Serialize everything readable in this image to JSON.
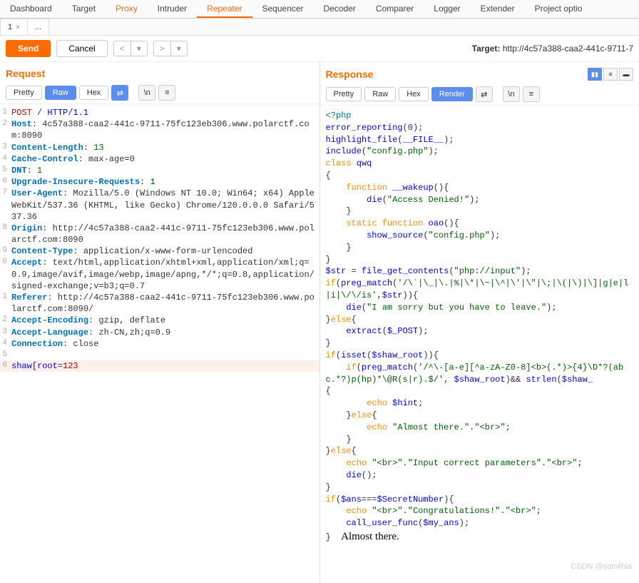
{
  "mainTabs": [
    "Dashboard",
    "Target",
    "Proxy",
    "Intruder",
    "Repeater",
    "Sequencer",
    "Decoder",
    "Comparer",
    "Logger",
    "Extender",
    "Project optio"
  ],
  "activeMainTab": "Repeater",
  "orangeTabs": [
    "Proxy",
    "Repeater"
  ],
  "subTabs": [
    {
      "label": "1",
      "close": true
    },
    {
      "label": "...",
      "close": false
    }
  ],
  "toolbar": {
    "send": "Send",
    "cancel": "Cancel",
    "prev": "<",
    "dd": "▾",
    "next": ">",
    "dd2": "▾",
    "targetLabel": "Target: ",
    "targetUrl": "http://4c57a388-caa2-441c-9711-7"
  },
  "request": {
    "title": "Request",
    "formats": [
      "Pretty",
      "Raw",
      "Hex"
    ],
    "selected": "Raw",
    "lines": [
      {
        "n": "1",
        "html": "<span class='r'>POST</span> / <span class='b'>HTTP/1.1</span>"
      },
      {
        "n": "2",
        "html": "<span class='k'>Host</span>: 4c57a388-caa2-441c-9711-75fc123eb306.www.polarctf.com:8090"
      },
      {
        "n": "3",
        "html": "<span class='k'>Content-Length</span>: <span class='v'>13</span>"
      },
      {
        "n": "4",
        "html": "<span class='k'>Cache-Control</span>: max-age=0"
      },
      {
        "n": "5",
        "html": "<span class='k'>DNT</span>: <span class='v'>1</span>"
      },
      {
        "n": "6",
        "html": "<span class='k'>Upgrade-Insecure-Requests</span>: <span class='v'>1</span>"
      },
      {
        "n": "7",
        "html": "<span class='k'>User-Agent</span>: Mozilla/5.0 (Windows NT 10.0; Win64; x64) AppleWebKit/537.36 (KHTML, like Gecko) Chrome/120.0.0.0 Safari/537.36"
      },
      {
        "n": "8",
        "html": "<span class='k'>Origin</span>: http://4c57a388-caa2-441c-9711-75fc123eb306.www.polarctf.com:8090"
      },
      {
        "n": "9",
        "html": "<span class='k'>Content-Type</span>: application/x-www-form-urlencoded"
      },
      {
        "n": "0",
        "html": "<span class='k'>Accept</span>: text/html,application/xhtml+xml,application/xml;q=0.9,image/avif,image/webp,image/apng,*/*;q=0.8,application/signed-exchange;v=b3;q=0.7"
      },
      {
        "n": "1",
        "html": "<span class='k'>Referer</span>: http://4c57a388-caa2-441c-9711-75fc123eb306.www.polarctf.com:8090/"
      },
      {
        "n": "2",
        "html": "<span class='k'>Accept-Encoding</span>: gzip, deflate"
      },
      {
        "n": "3",
        "html": "<span class='k'>Accept-Language</span>: zh-CN,zh;q=0.9"
      },
      {
        "n": "4",
        "html": "<span class='k'>Connection</span>: close"
      },
      {
        "n": "5",
        "html": ""
      },
      {
        "n": "6",
        "html": "<span class='b'>shaw[root</span>=<span class='r'>123</span>",
        "hl": true
      }
    ]
  },
  "response": {
    "title": "Response",
    "formats": [
      "Pretty",
      "Raw",
      "Hex",
      "Render"
    ],
    "selected": "Render",
    "bodyHtml": "<span class='p'>&lt;?php</span>\n<span class='b'>error_reporting</span>(<span class='m'>0</span>);\n<span class='b'>highlight_file</span>(<span class='b'>__FILE__</span>);\n<span class='b'>include</span>(<span class='s'>\"config.php\"</span>);\n<span class='o'>class</span> <span class='b'>qwq</span>\n{\n    <span class='o'>function</span> <span class='b'>__wakeup</span>(){\n        <span class='b'>die</span>(<span class='s'>\"Access Denied!\"</span>);\n    }\n    <span class='o'>static</span> <span class='o'>function</span> <span class='b'>oao</span>(){\n        <span class='b'>show_source</span>(<span class='s'>\"config.php\"</span>);\n    }\n}\n<span class='b'>$str</span> = <span class='b'>file_get_contents</span>(<span class='s'>\"php://input\"</span>);\n<span class='o'>if</span>(<span class='b'>preg_match</span>(<span class='s'>'/\\`|\\_|\\.|%|\\*|\\~|\\^|\\'|\\\"|\\;|\\(|\\)|\\]|g|e|l|i|\\/\\/is'</span>,<span class='b'>$str</span>)){\n    <span class='b'>die</span>(<span class='s'>\"I am sorry but you have to leave.\"</span>);\n}<span class='o'>else</span>{\n    <span class='b'>extract</span>(<span class='b'>$_POST</span>);\n}\n<span class='o'>if</span>(<span class='b'>isset</span>(<span class='b'>$shaw_root</span>)){\n    <span class='o'>if</span>(<span class='b'>preg_match</span>(<span class='s'>'/^\\-[a-e][^a-zA-Z0-8]&lt;b&gt;(.*)&gt;{4}\\D*?(abc.*?)p(hp)*\\@R(s|r).$/'</span>, <span class='b'>$shaw_root</span>)&amp;&amp; <span class='b'>strlen</span>(<span class='b'>$shaw_</span>\n{\n        <span class='o'>echo</span> <span class='b'>$hint</span>;\n    }<span class='o'>else</span>{\n        <span class='o'>echo</span> <span class='s'>\"Almost there.\"</span>.<span class='s'>\"&lt;br&gt;\"</span>;\n    }\n}<span class='o'>else</span>{\n    <span class='o'>echo</span> <span class='s'>\"&lt;br&gt;\"</span>.<span class='s'>\"Input correct parameters\"</span>.<span class='s'>\"&lt;br&gt;\"</span>;\n    <span class='b'>die</span>();\n}\n<span class='o'>if</span>(<span class='b'>$ans</span>===<span class='b'>$SecretNumber</span>){\n    <span class='o'>echo</span> <span class='s'>\"&lt;br&gt;\"</span>.<span class='s'>\"Congratulations!\"</span>.<span class='s'>\"&lt;br&gt;\"</span>;\n    <span class='b'>call_user_func</span>(<span class='b'>$my_ans</span>);\n}  <span style='font-family:serif;font-size:15px;color:#000'>Almost there.</span>"
  },
  "watermark": "CSDN @samRsa"
}
